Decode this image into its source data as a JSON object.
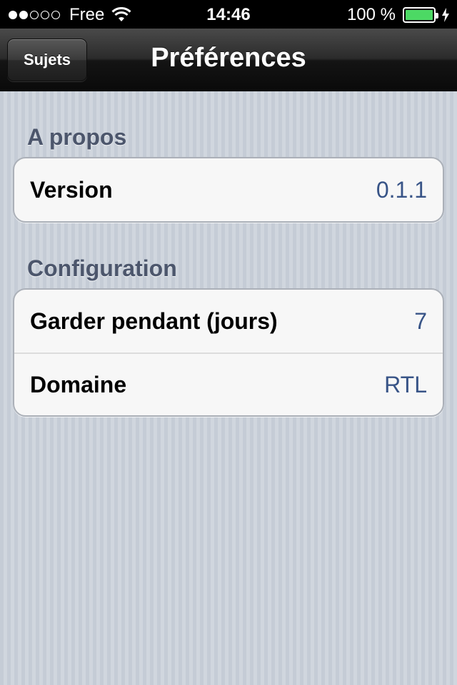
{
  "status_bar": {
    "carrier": "Free",
    "time": "14:46",
    "battery_percent": "100 %",
    "signal_bars": 2,
    "signal_total": 5,
    "battery_level": 1.0,
    "battery_color": "#4cd964"
  },
  "nav": {
    "back_label": "Sujets",
    "title": "Préférences"
  },
  "sections": [
    {
      "header": "A propos",
      "rows": [
        {
          "label": "Version",
          "value": "0.1.1"
        }
      ]
    },
    {
      "header": "Configuration",
      "rows": [
        {
          "label": "Garder pendant (jours)",
          "value": "7"
        },
        {
          "label": "Domaine",
          "value": "RTL"
        }
      ]
    }
  ],
  "colors": {
    "value_text": "#385487",
    "section_header": "#4c566c"
  }
}
